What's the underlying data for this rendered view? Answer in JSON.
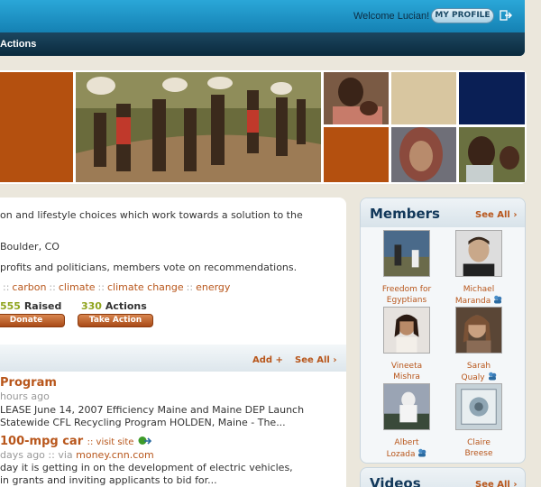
{
  "header": {
    "welcome": "Welcome Lucian!",
    "profile_button": "MY PROFILE",
    "logout_icon": "logout-icon",
    "nav_actions": "Actions"
  },
  "cause": {
    "description": "on and lifestyle choices which work towards a solution to the",
    "location": "Boulder, CO",
    "vote_note": "profits and politicians, members vote on recommendations.",
    "tags": [
      "carbon",
      "climate",
      "climate change",
      "energy"
    ],
    "raised_number": "555",
    "raised_label": "Raised",
    "actions_number": "330",
    "actions_label": "Actions",
    "donate_label": "Donate",
    "take_action_label": "Take Action"
  },
  "list": {
    "add_label": "Add +",
    "see_all_label": "See All ›",
    "items": [
      {
        "title": "Program",
        "meta": "hours ago",
        "line1": "LEASE June 14, 2007 Efficiency Maine and Maine DEP Launch",
        "line2": "Statewide CFL Recycling Program HOLDEN, Maine - The..."
      },
      {
        "title": "100-mpg car",
        "visit_site": ":: visit site",
        "meta_prefix": "days ago :: via",
        "source": "money.cnn.com",
        "line1": "day it is getting in on the development of electric vehicles,",
        "line2": "in grants and inviting applicants to bid for..."
      }
    ]
  },
  "sidebar": {
    "members_title": "Members",
    "see_all_label": "See All ›",
    "members": [
      {
        "line1": "Freedom for",
        "line2": "Egyptians",
        "friend": false
      },
      {
        "line1": "Michael",
        "line2": "Maranda",
        "friend": true
      },
      {
        "line1": "Vineeta",
        "line2": "Mishra",
        "friend": false
      },
      {
        "line1": "Sarah",
        "line2": "Qualy",
        "friend": true
      },
      {
        "line1": "Albert",
        "line2": "Lozada",
        "friend": true
      },
      {
        "line1": "Claire",
        "line2": "Breese",
        "friend": false
      }
    ],
    "videos_title": "Videos",
    "videos_see_all": "See All ›"
  },
  "colors": {
    "accent_orange": "#b8561b",
    "header_blue": "#1683b5",
    "navy": "#12385a",
    "green_numbers": "#8fa41d"
  }
}
